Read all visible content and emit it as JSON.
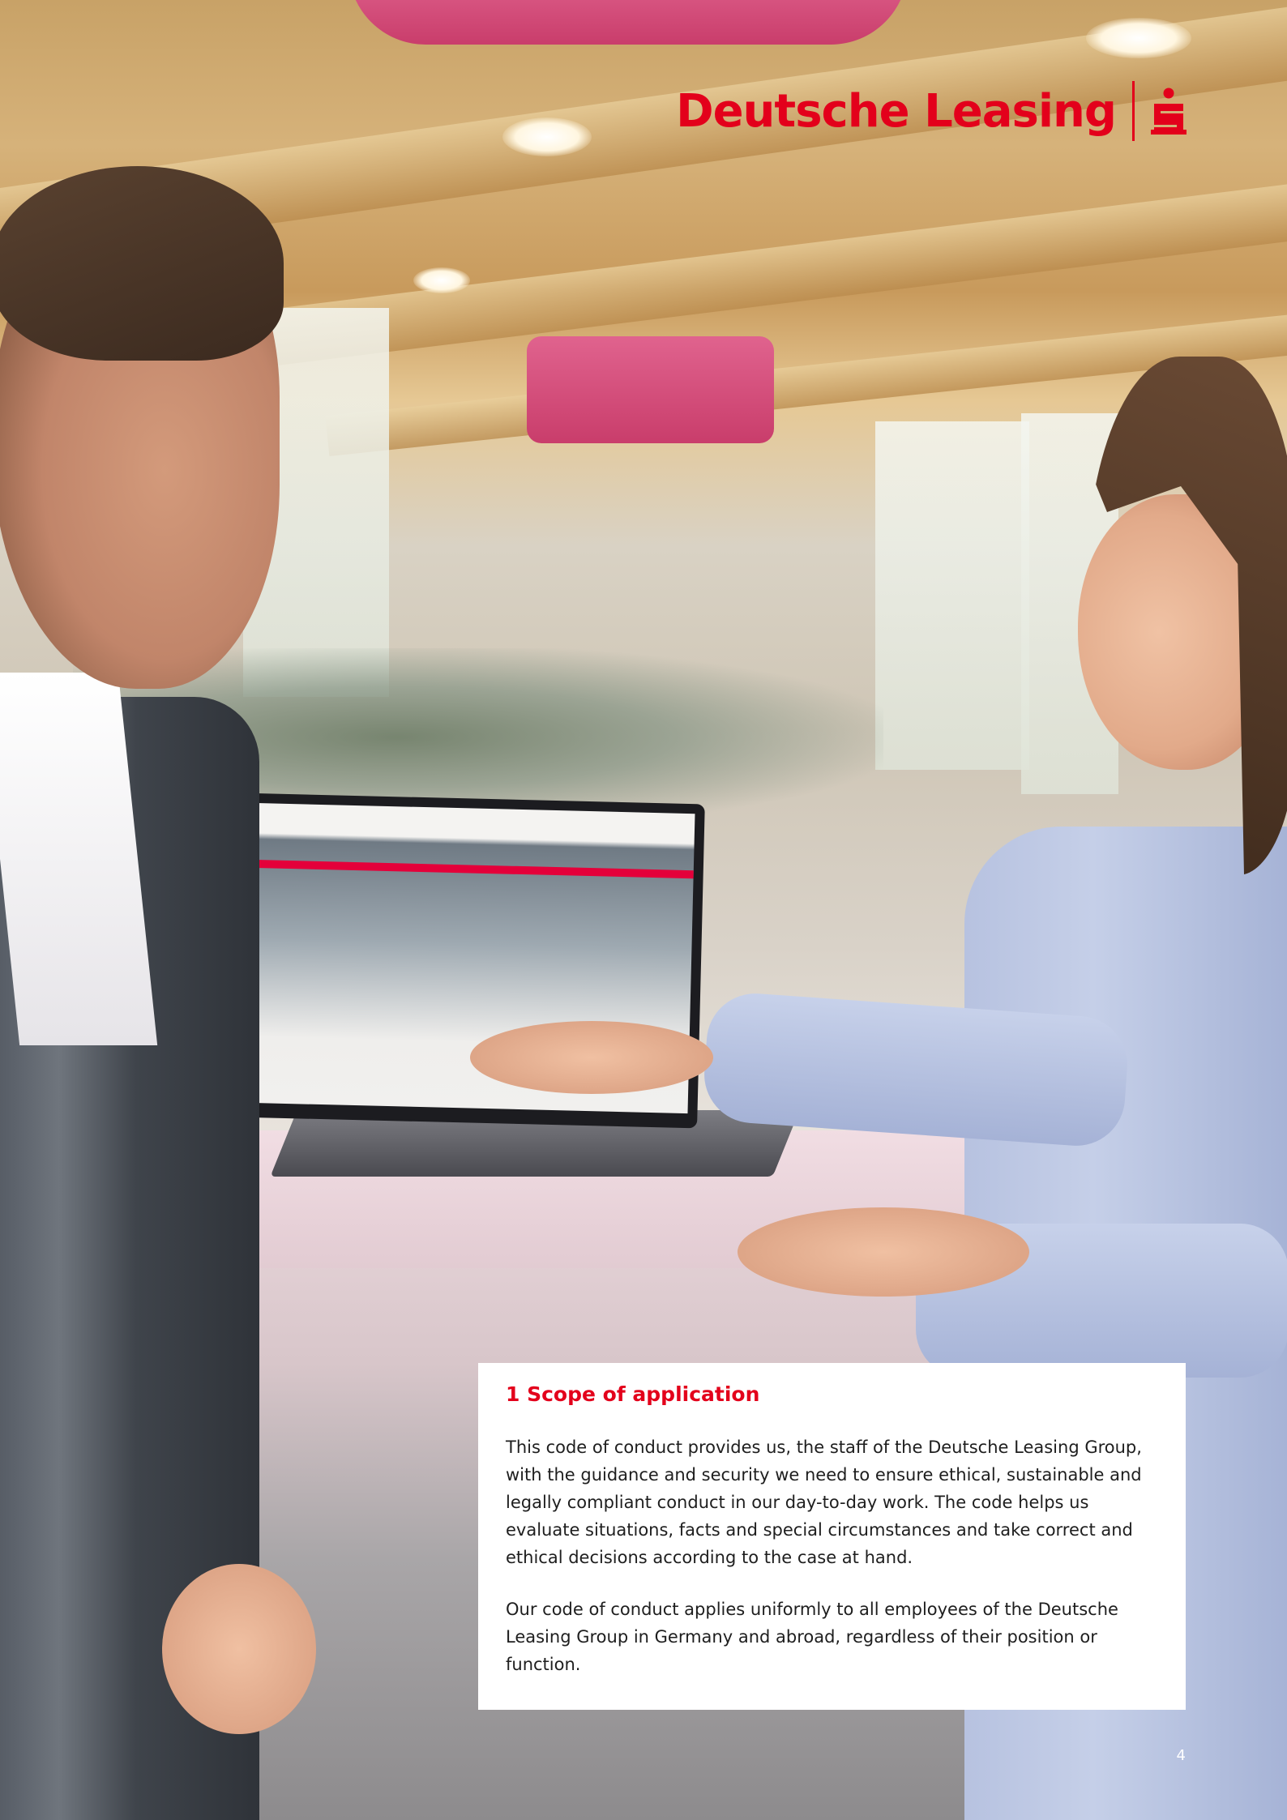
{
  "brand": {
    "name": "Deutsche Leasing",
    "color": "#e3001b",
    "symbol": "sparkasse-s-icon"
  },
  "section": {
    "heading": "1 Scope of application",
    "paragraphs": [
      "This code of conduct provides us, the staff of the Deutsche Leasing Group, with the guidance and security we need to ensure ethical, sustainable and legally compliant conduct in our day-to-day work. The code helps us evaluate situations, facts and special circumstances and take correct and ethical decisions according to the case at hand.",
      "Our code of conduct applies uniformly to all employees of the Deutsche Leasing Group in Germany and abroad, regardless of their position or function."
    ]
  },
  "page_number": "4"
}
